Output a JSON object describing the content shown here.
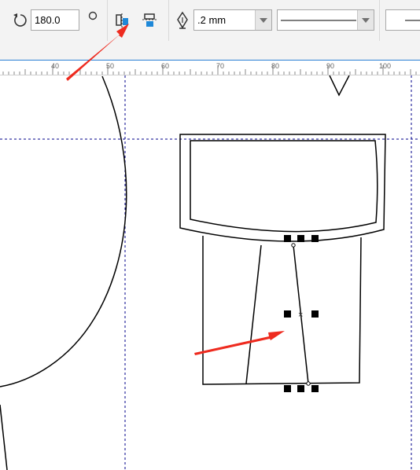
{
  "toolbar": {
    "rotation_value": "180.0",
    "outline_width": ".2 mm",
    "tools": [
      "rotate-icon",
      "origin-circle-icon",
      "mirror-horizontal-icon",
      "mirror-vertical-icon",
      "pen-nib-icon"
    ]
  },
  "ruler": {
    "labels": [
      "40",
      "50",
      "60",
      "70",
      "80",
      "90",
      "100"
    ]
  },
  "colors": {
    "accent": "#1e88d8",
    "guide": "#00008b",
    "annotation_arrow": "#ee2b1f"
  }
}
